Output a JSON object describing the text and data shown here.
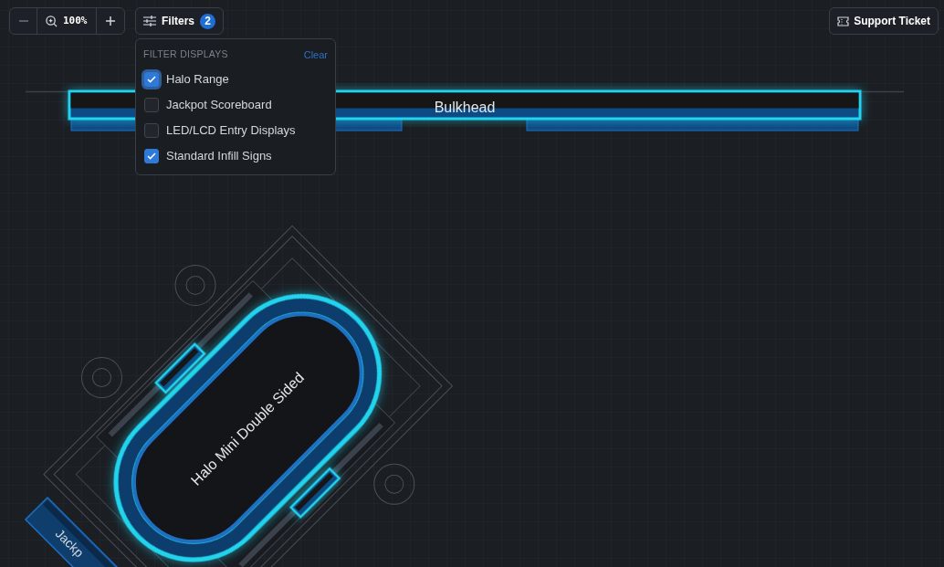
{
  "toolbar": {
    "zoom": {
      "value": "100%"
    },
    "filters_button": {
      "label": "Filters",
      "badge": "2"
    },
    "support_button": {
      "label": "Support Ticket"
    }
  },
  "filter_menu": {
    "heading": "FILTER DISPLAYS",
    "clear": "Clear",
    "options": [
      {
        "label": "Halo Range",
        "checked": true,
        "focused": true
      },
      {
        "label": "Jackpot Scoreboard",
        "checked": false,
        "focused": false
      },
      {
        "label": "LED/LCD Entry Displays",
        "checked": false,
        "focused": false
      },
      {
        "label": "Standard Infill Signs",
        "checked": true,
        "focused": false
      }
    ]
  },
  "canvas": {
    "displays": [
      {
        "kind": "bulkhead",
        "label": "Bulkhead"
      },
      {
        "kind": "halo",
        "label": "Halo Mini Double Sided"
      },
      {
        "kind": "jackpot",
        "label": "Jackp"
      }
    ]
  }
}
